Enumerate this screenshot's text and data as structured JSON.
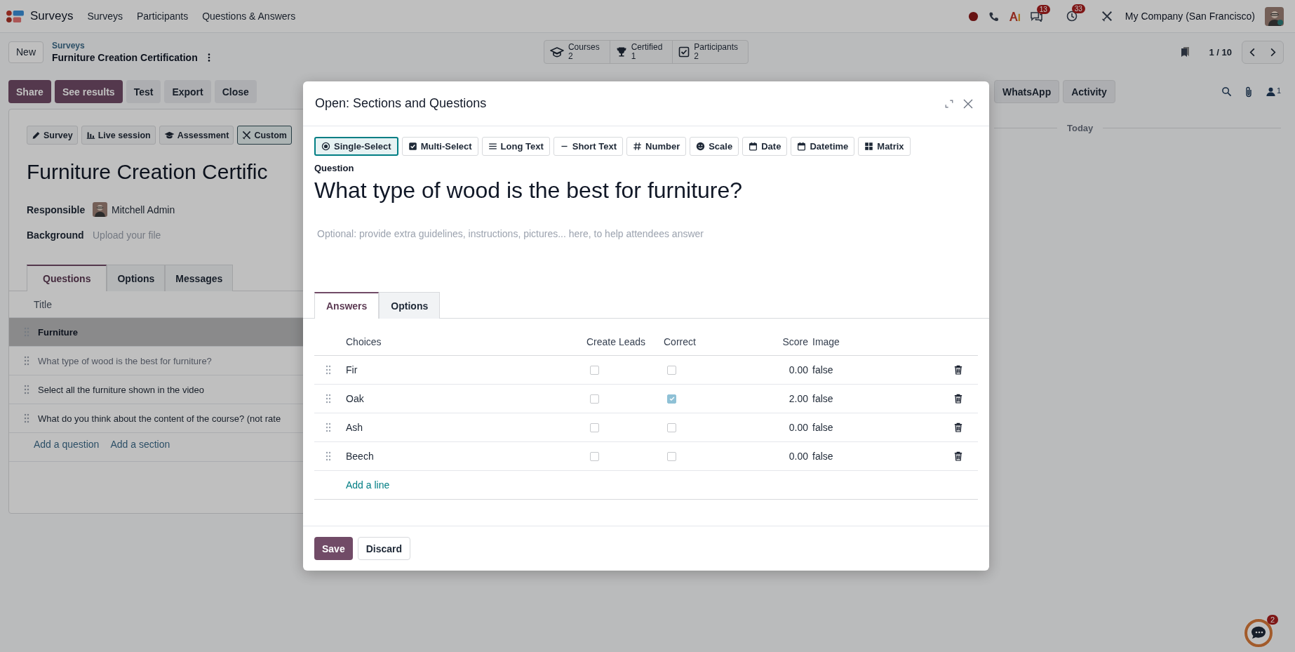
{
  "navbar": {
    "app_name": "Surveys",
    "menu": [
      "Surveys",
      "Participants",
      "Questions & Answers"
    ],
    "systray": {
      "messages_badge": "13",
      "activities_badge": "33",
      "company": "My Company (San Francisco)"
    }
  },
  "control_panel": {
    "new_button": "New",
    "breadcrumb": {
      "parent": "Surveys",
      "current": "Furniture Creation Certification"
    },
    "stat_buttons": [
      {
        "label": "Courses",
        "value": "2"
      },
      {
        "label": "Certified",
        "value": "1"
      },
      {
        "label": "Participants",
        "value": "2"
      }
    ],
    "pager": "1 / 10"
  },
  "actions": [
    {
      "label": "Share",
      "kind": "primary"
    },
    {
      "label": "See results",
      "kind": "primary"
    },
    {
      "label": "Test",
      "kind": "secondary"
    },
    {
      "label": "Export",
      "kind": "secondary"
    },
    {
      "label": "Close",
      "kind": "secondary"
    }
  ],
  "form": {
    "survey_types": [
      {
        "label": "Survey",
        "selected": false
      },
      {
        "label": "Live session",
        "selected": false
      },
      {
        "label": "Assessment",
        "selected": false
      },
      {
        "label": "Custom",
        "selected": true
      }
    ],
    "title": "Furniture Creation Certific",
    "fields": [
      {
        "label": "Responsible",
        "kind": "user",
        "value": "Mitchell Admin"
      },
      {
        "label": "Background",
        "kind": "file",
        "placeholder": "Upload your file"
      }
    ],
    "tabs": [
      {
        "label": "Questions",
        "selected": true
      },
      {
        "label": "Options",
        "selected": false
      },
      {
        "label": "Messages",
        "selected": false
      }
    ],
    "questions": {
      "columns": [
        "Title"
      ],
      "rows": [
        {
          "title": "Furniture",
          "kind": "section",
          "greyed": false
        },
        {
          "title": "What type of wood is the best for furniture?",
          "kind": "question",
          "greyed": true
        },
        {
          "title": "Select all the furniture shown in the video",
          "kind": "question",
          "greyed": false
        },
        {
          "title": "What do you think about the content of the course? (not rate",
          "kind": "question",
          "greyed": false
        }
      ],
      "links": [
        "Add a question",
        "Add a section"
      ]
    }
  },
  "chatter": {
    "buttons": [
      "WhatsApp",
      "Activity"
    ],
    "followers": "1",
    "date_divider": "Today"
  },
  "modal": {
    "title": "Open: Sections and Questions",
    "question_types": [
      {
        "label": "Single-Select",
        "selected": true
      },
      {
        "label": "Multi-Select",
        "selected": false
      },
      {
        "label": "Long Text",
        "selected": false
      },
      {
        "label": "Short Text",
        "selected": false
      },
      {
        "label": "Number",
        "selected": false
      },
      {
        "label": "Scale",
        "selected": false
      },
      {
        "label": "Date",
        "selected": false
      },
      {
        "label": "Datetime",
        "selected": false
      },
      {
        "label": "Matrix",
        "selected": false
      }
    ],
    "question_label": "Question",
    "question": "What type of wood is the best for furniture?",
    "description_placeholder": "Optional: provide extra guidelines, instructions, pictures... here, to help attendees answer",
    "tabs": [
      {
        "label": "Answers",
        "selected": true
      },
      {
        "label": "Options",
        "selected": false
      }
    ],
    "answers": {
      "columns": [
        "Choices",
        "Create Leads",
        "Correct",
        "Score",
        "Image"
      ],
      "rows": [
        {
          "choice": "Fir",
          "create_leads": false,
          "correct": false,
          "score": "0.00",
          "image": "false"
        },
        {
          "choice": "Oak",
          "create_leads": false,
          "correct": true,
          "score": "2.00",
          "image": "false"
        },
        {
          "choice": "Ash",
          "create_leads": false,
          "correct": false,
          "score": "0.00",
          "image": "false"
        },
        {
          "choice": "Beech",
          "create_leads": false,
          "correct": false,
          "score": "0.00",
          "image": "false"
        }
      ],
      "add_line": "Add a line"
    },
    "buttons": [
      {
        "label": "Save",
        "kind": "primary"
      },
      {
        "label": "Discard",
        "kind": "secondary"
      }
    ]
  },
  "chat_bubble": {
    "badge": "2"
  }
}
